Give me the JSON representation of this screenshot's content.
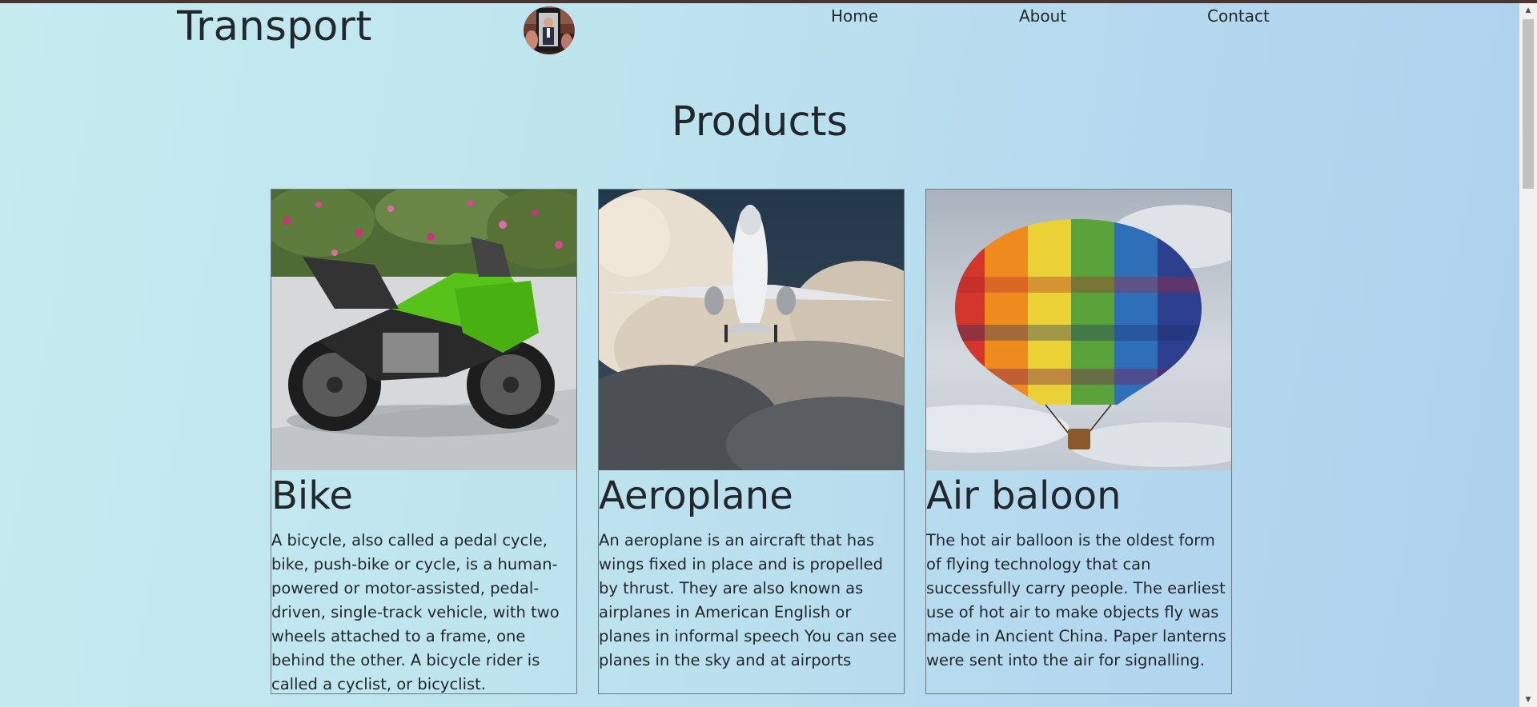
{
  "header": {
    "logo": "Transport",
    "nav": [
      {
        "label": "Home"
      },
      {
        "label": "About"
      },
      {
        "label": "Contact"
      }
    ]
  },
  "main": {
    "title": "Products",
    "cards": [
      {
        "title": "Bike",
        "image": "green-motorcycle-photo",
        "description": "A bicycle, also called a pedal cycle, bike, push-bike or cycle, is a human-powered or motor-assisted, pedal-driven, single-track vehicle, with two wheels attached to a frame, one behind the other. A bicycle rider is called a cyclist, or bicyclist."
      },
      {
        "title": "Aeroplane",
        "image": "airplane-in-clouds-photo",
        "description": "An aeroplane is an aircraft that has wings fixed in place and is propelled by thrust. They are also known as airplanes in American English or planes in informal speech You can see planes in the sky and at airports"
      },
      {
        "title": "Air baloon",
        "image": "hot-air-balloon-photo",
        "description": "The hot air balloon is the oldest form of flying technology that can successfully carry people. The earliest use of hot air to make objects fly was made in Ancient China. Paper lanterns were sent into the air for signalling."
      }
    ]
  },
  "colors": {
    "background_start": "#c6ecf0",
    "background_end": "#aed1ec",
    "text": "#22272b",
    "top_strip": "#4a3434"
  }
}
